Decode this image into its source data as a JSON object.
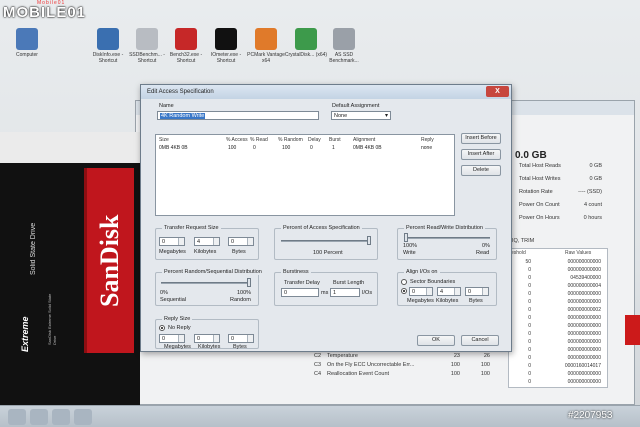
{
  "watermark": {
    "brand": "MOBILE01",
    "sub": "Mobile01"
  },
  "photo_id": "#2207953",
  "desktop_icons": [
    {
      "label": "Computer"
    },
    {
      "label": "DiskInfo.exe - Shortcut"
    },
    {
      "label": "SSDBenchm... - Shortcut"
    },
    {
      "label": "Bench32.exe - Shortcut"
    },
    {
      "label": "IOmeter.exe - Shortcut"
    },
    {
      "label": "PCMark Vantage x64"
    },
    {
      "label": "CrystalDisk... (x64)"
    },
    {
      "label": "AS SSD Benchmark..."
    }
  ],
  "ssd_box": {
    "brand": "SanDisk",
    "line": "Solid State Drive",
    "product": "Extreme",
    "caption": "SanDisk Extreme Solid State Drive"
  },
  "bg_app": {
    "big_value": "0.0 GB",
    "stats": [
      {
        "label": "Total Host Reads",
        "value": "0 GB"
      },
      {
        "label": "Total Host Writes",
        "value": "0 GB"
      },
      {
        "label": "Rotation Rate",
        "value": "---- (SSD)"
      },
      {
        "label": "Power On Count",
        "value": "4 count"
      },
      {
        "label": "Power On Hours",
        "value": "0 hours"
      }
    ],
    "features_label": "IQ, TRIM",
    "raw_header": {
      "threshold": "eshold",
      "raw": "Raw Values"
    },
    "raw_rows": [
      {
        "th": "50",
        "raw": "000000000000"
      },
      {
        "th": "0",
        "raw": "000000000000"
      },
      {
        "th": "0",
        "raw": "04539400000"
      },
      {
        "th": "0",
        "raw": "000000000004"
      },
      {
        "th": "0",
        "raw": "000000000000"
      },
      {
        "th": "0",
        "raw": "000000000000"
      },
      {
        "th": "0",
        "raw": "000000000002"
      },
      {
        "th": "0",
        "raw": "000000000000"
      },
      {
        "th": "0",
        "raw": "000000000000"
      },
      {
        "th": "0",
        "raw": "000000000000"
      },
      {
        "th": "0",
        "raw": "000000000000"
      },
      {
        "th": "0",
        "raw": "000000000000"
      },
      {
        "th": "0",
        "raw": "000000000000"
      },
      {
        "th": "0",
        "raw": "0000160014017"
      },
      {
        "th": "0",
        "raw": "000000000000"
      },
      {
        "th": "0",
        "raw": "000000000000"
      }
    ],
    "attr_rows": [
      {
        "id": "C2",
        "name": "Temperature",
        "cur": "23",
        "worst": "26"
      },
      {
        "id": "C3",
        "name": "On the Fly ECC Uncorrectable Err...",
        "cur": "100",
        "worst": "100"
      },
      {
        "id": "C4",
        "name": "Reallocation Event Count",
        "cur": "100",
        "worst": "100"
      }
    ]
  },
  "dialog": {
    "title": "Edit Access Specification",
    "close": "X",
    "name_label": "Name",
    "name_value": "4K Random Write",
    "default_assignment_label": "Default Assignment",
    "default_assignment_value": "None",
    "columns": [
      "Size",
      "% Access",
      "% Read",
      "% Random",
      "Delay",
      "Burst",
      "Alignment",
      "Reply"
    ],
    "rows": [
      {
        "size": "0MB  4KB  0B",
        "access": "100",
        "read": "0",
        "random": "100",
        "delay": "0",
        "burst": "1",
        "alignment": "0MB  4KB  0B",
        "reply": "none"
      }
    ],
    "insert_before": "Insert Before",
    "insert_after": "Insert After",
    "delete": "Delete",
    "transfer_request_size": {
      "title": "Transfer Request Size",
      "megabytes": "0",
      "kilobytes": "4",
      "bytes": "0",
      "megabytes_label": "Megabytes",
      "kilobytes_label": "Kilobytes",
      "bytes_label": "Bytes"
    },
    "percent_access": {
      "title": "Percent of Access Specification",
      "value_label": "100 Percent",
      "value": 1.0
    },
    "percent_read_write": {
      "title": "Percent Read/Write Distribution",
      "left": "100%",
      "left_sub": "Write",
      "right": "0%",
      "right_sub": "Read",
      "value": 0.0
    },
    "percent_random": {
      "title": "Percent Random/Sequential Distribution",
      "left": "0%",
      "left_sub": "Sequential",
      "right": "100%",
      "right_sub": "Random",
      "value": 1.0
    },
    "burstiness": {
      "title": "Burstiness",
      "transfer_delay_label": "Transfer Delay",
      "transfer_delay": "0",
      "ms": "ms",
      "burst_length_label": "Burst Length",
      "burst_length": "1",
      "ios": "I/Os"
    },
    "align": {
      "title": "Align I/Os on",
      "sector_boundaries": "Sector Boundaries",
      "megabytes": "0",
      "kilobytes": "4",
      "bytes": "0",
      "megabytes_label": "Megabytes",
      "kilobytes_label": "Kilobytes",
      "bytes_label": "Bytes"
    },
    "reply_size": {
      "title": "Reply Size",
      "no_reply": "No Reply",
      "megabytes": "0",
      "kilobytes": "0",
      "bytes": "0",
      "megabytes_label": "Megabytes",
      "kilobytes_label": "Kilobytes",
      "bytes_label": "Bytes"
    },
    "ok": "OK",
    "cancel": "Cancel"
  },
  "colors": {
    "brand_red": "#c0161d",
    "dialog_bg": "#e4e8ed",
    "selection": "#3a78c8"
  }
}
